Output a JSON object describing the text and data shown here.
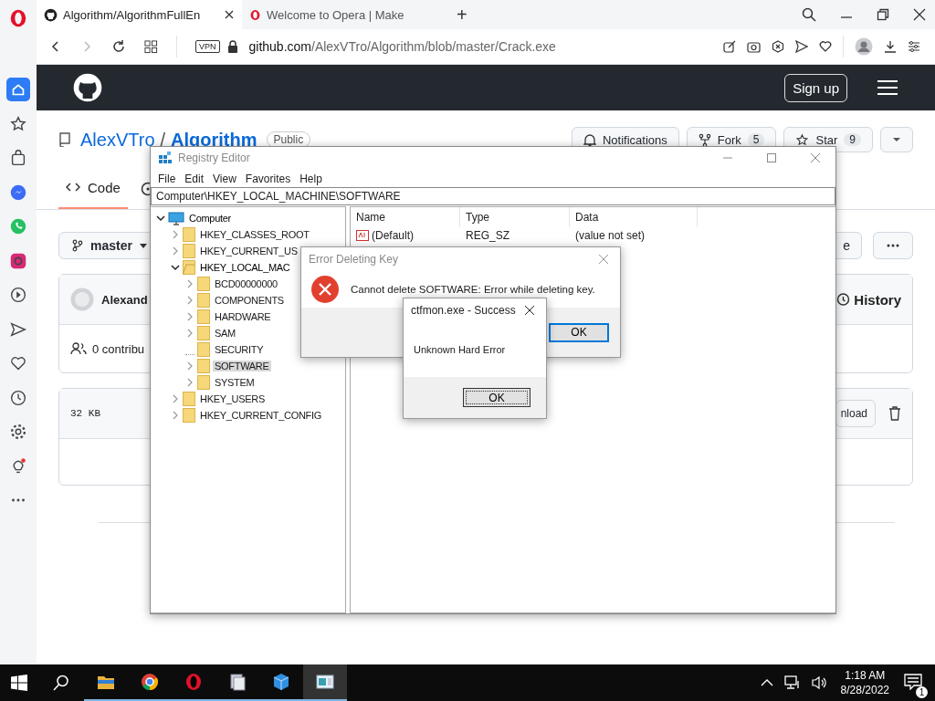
{
  "browser": {
    "tabs": [
      {
        "title": "Algorithm/AlgorithmFullEn",
        "selected": true
      },
      {
        "title": "Welcome to Opera | Make",
        "selected": false
      }
    ],
    "new_tab": "+",
    "address": {
      "vpn": "VPN",
      "domain": "github.com",
      "path": "/AlexVTro/Algorithm/blob/master/Crack.exe"
    }
  },
  "sidebar": {
    "items": [
      {
        "kind": "home",
        "selected": true
      },
      {
        "kind": "star",
        "selected": false
      },
      {
        "kind": "bag",
        "selected": false
      },
      {
        "kind": "messenger",
        "selected": false
      },
      {
        "kind": "whatsapp",
        "selected": false
      },
      {
        "kind": "instagram",
        "selected": false
      },
      {
        "kind": "play",
        "selected": false
      },
      {
        "kind": "send",
        "selected": false
      },
      {
        "kind": "heart",
        "selected": false
      },
      {
        "kind": "clock",
        "selected": false
      },
      {
        "kind": "gear",
        "selected": false
      },
      {
        "kind": "bulb",
        "selected": false
      },
      {
        "kind": "more",
        "selected": false
      }
    ]
  },
  "github": {
    "sign_up": "Sign up",
    "owner": "AlexVTro",
    "separator": "/",
    "repo": "Algorithm",
    "visibility": "Public",
    "actions": [
      {
        "kind": "bell",
        "label": "Notifications"
      },
      {
        "kind": "fork",
        "label": "Fork",
        "count": "5"
      },
      {
        "kind": "star",
        "label": "Star",
        "count": "9"
      }
    ],
    "tabs": [
      {
        "label": "Code",
        "selected": true
      }
    ],
    "branch": "master",
    "file_button": "e",
    "commit": {
      "author": "Alexand",
      "history": "History"
    },
    "contributors": "0 contribu",
    "file": {
      "size": "32 KB",
      "download": "nload"
    }
  },
  "registry": {
    "title": "Registry Editor",
    "menu": [
      "File",
      "Edit",
      "View",
      "Favorites",
      "Help"
    ],
    "address": "Computer\\HKEY_LOCAL_MACHINE\\SOFTWARE",
    "tree": [
      {
        "label": "Computer",
        "kind": "computer",
        "expandable": true,
        "expanded": true,
        "selected": false,
        "children": [
          {
            "label": "HKEY_CLASSES_ROOT",
            "kind": "folder",
            "expandable": true,
            "expanded": false,
            "selected": false
          },
          {
            "label": "HKEY_CURRENT_US",
            "kind": "folder",
            "expandable": true,
            "expanded": false,
            "selected": false
          },
          {
            "label": "HKEY_LOCAL_MAC",
            "kind": "folder",
            "expandable": true,
            "expanded": true,
            "selected": false,
            "children": [
              {
                "label": "BCD00000000",
                "kind": "folder",
                "expandable": true,
                "expanded": false,
                "selected": false
              },
              {
                "label": "COMPONENTS",
                "kind": "folder",
                "expandable": true,
                "expanded": false,
                "selected": false
              },
              {
                "label": "HARDWARE",
                "kind": "folder",
                "expandable": true,
                "expanded": false,
                "selected": false
              },
              {
                "label": "SAM",
                "kind": "folder",
                "expandable": true,
                "expanded": false,
                "selected": false
              },
              {
                "label": "SECURITY",
                "kind": "folder",
                "expandable": false,
                "expanded": false,
                "selected": false
              },
              {
                "label": "SOFTWARE",
                "kind": "folder",
                "expandable": true,
                "expanded": false,
                "selected": true
              },
              {
                "label": "SYSTEM",
                "kind": "folder",
                "expandable": true,
                "expanded": false,
                "selected": false
              }
            ]
          },
          {
            "label": "HKEY_USERS",
            "kind": "folder",
            "expandable": true,
            "expanded": false,
            "selected": false
          },
          {
            "label": "HKEY_CURRENT_CONFIG",
            "kind": "folder",
            "expandable": true,
            "expanded": false,
            "selected": false
          }
        ]
      }
    ],
    "columns": [
      "Name",
      "Type",
      "Data"
    ],
    "rows": [
      {
        "name": "(Default)",
        "type": "REG_SZ",
        "data": "(value not set)"
      }
    ]
  },
  "error_dialog": {
    "title": "Error Deleting Key",
    "message": "Cannot delete SOFTWARE:  Error while deleting key.",
    "button": "OK"
  },
  "success_dialog": {
    "title": "ctfmon.exe - Success",
    "message": "Unknown Hard Error",
    "button": "OK"
  },
  "taskbar": {
    "apps": [
      {
        "kind": "folder",
        "running": true,
        "selected": false
      },
      {
        "kind": "chrome",
        "running": true,
        "selected": false
      },
      {
        "kind": "opera",
        "running": true,
        "selected": false
      },
      {
        "kind": "files",
        "running": true,
        "selected": false
      },
      {
        "kind": "cube",
        "running": true,
        "selected": false
      },
      {
        "kind": "regedit",
        "running": true,
        "selected": true
      }
    ],
    "time": "1:18 AM",
    "date": "8/28/2022",
    "notifications": "1"
  }
}
